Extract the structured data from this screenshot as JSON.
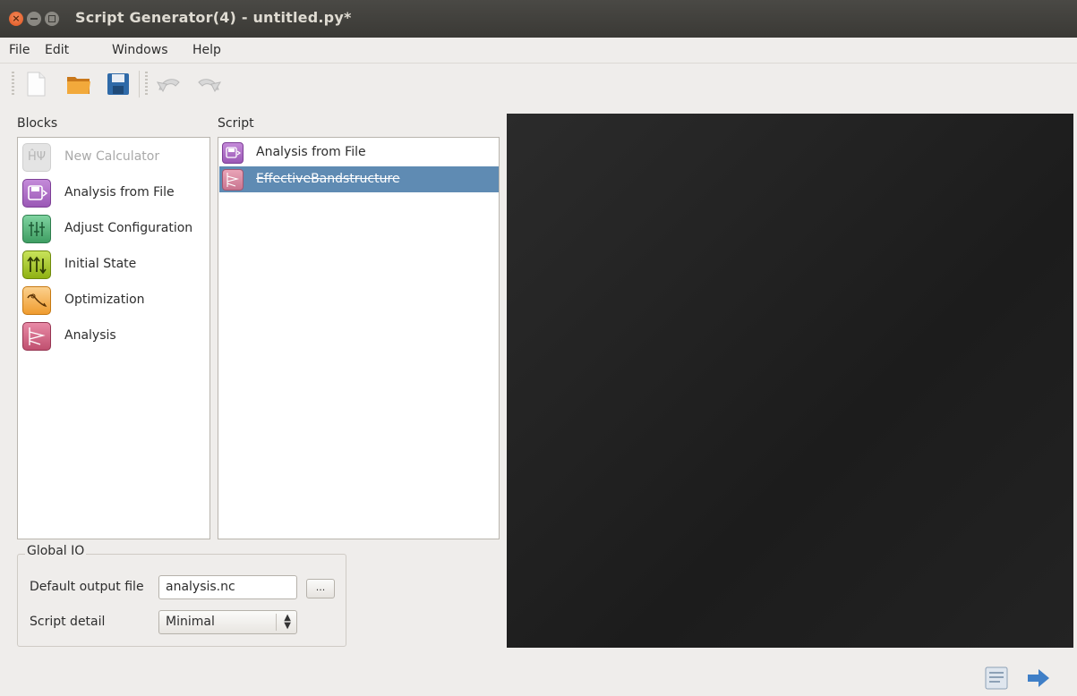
{
  "window": {
    "title": "Script Generator(4) - untitled.py*"
  },
  "menu": [
    "File",
    "Edit",
    "Windows",
    "Help"
  ],
  "toolbar": [
    "new-file-icon",
    "open-folder-icon",
    "save-icon",
    "undo-icon",
    "redo-icon"
  ],
  "blocks": {
    "label": "Blocks",
    "items": [
      {
        "label": "New Calculator",
        "enabled": false,
        "icon": "calculator-icon",
        "color": "#d6d6d6"
      },
      {
        "label": "Analysis from File",
        "enabled": true,
        "icon": "analysis-file-icon",
        "color": "#9b59b6"
      },
      {
        "label": "Adjust Configuration",
        "enabled": true,
        "icon": "adjust-configuration-icon",
        "color": "#4caf73"
      },
      {
        "label": "Initial State",
        "enabled": true,
        "icon": "initial-state-icon",
        "color": "#a6c51a"
      },
      {
        "label": "Optimization",
        "enabled": true,
        "icon": "optimization-icon",
        "color": "#f0a33a"
      },
      {
        "label": "Analysis",
        "enabled": true,
        "icon": "analysis-icon",
        "color": "#c0506f"
      }
    ]
  },
  "script": {
    "label": "Script",
    "items": [
      {
        "label": "Analysis from File",
        "selected": false,
        "struck": false,
        "icon": "analysis-file-icon"
      },
      {
        "label": "EffectiveBandstructure",
        "selected": true,
        "struck": true,
        "icon": "analysis-icon"
      }
    ]
  },
  "global_io": {
    "title": "Global IO",
    "output_label": "Default output file",
    "output_value": "analysis.nc",
    "browse_label": "...",
    "detail_label": "Script detail",
    "detail_value": "Minimal"
  },
  "colors": {
    "selection": "#5f8bb3",
    "preview_bg": "#222222"
  }
}
